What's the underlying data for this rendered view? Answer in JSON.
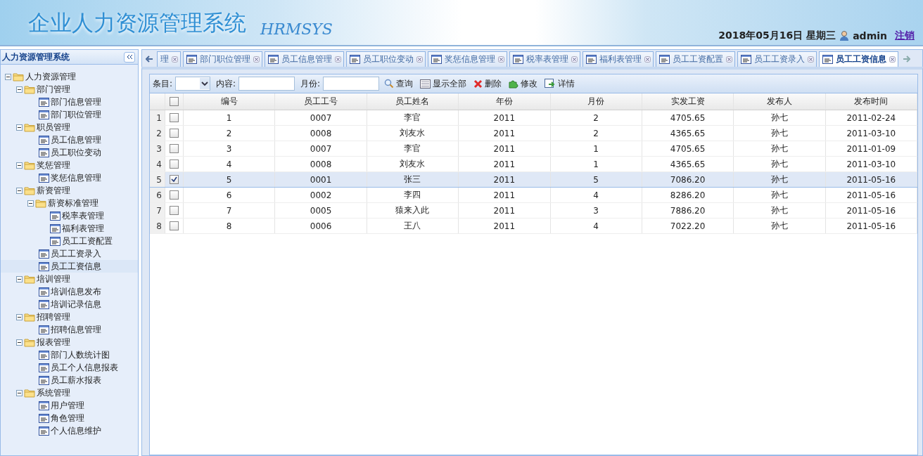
{
  "header": {
    "title": "企业人力资源管理系统",
    "subtitle": "HRMSYS",
    "date": "2018年05月16日 星期三",
    "user": "admin",
    "logout": "注销"
  },
  "sidebar": {
    "title": "人力资源管理系统",
    "tree": [
      {
        "label": "人力资源管理",
        "expanded": true,
        "children": [
          {
            "label": "部门管理",
            "expanded": true,
            "children": [
              {
                "label": "部门信息管理",
                "selected": false
              },
              {
                "label": "部门职位管理",
                "selected": false
              }
            ]
          },
          {
            "label": "职员管理",
            "expanded": true,
            "children": [
              {
                "label": "员工信息管理",
                "selected": false
              },
              {
                "label": "员工职位变动",
                "selected": false
              }
            ]
          },
          {
            "label": "奖惩管理",
            "expanded": true,
            "children": [
              {
                "label": "奖惩信息管理",
                "selected": false
              }
            ]
          },
          {
            "label": "薪资管理",
            "expanded": true,
            "children": [
              {
                "label": "薪资标准管理",
                "expanded": true,
                "children": [
                  {
                    "label": "税率表管理",
                    "selected": false
                  },
                  {
                    "label": "福利表管理",
                    "selected": false
                  },
                  {
                    "label": "员工工资配置",
                    "selected": false
                  }
                ]
              },
              {
                "label": "员工工资录入",
                "selected": false
              },
              {
                "label": "员工工资信息",
                "selected": true
              }
            ]
          },
          {
            "label": "培训管理",
            "expanded": true,
            "children": [
              {
                "label": "培训信息发布",
                "selected": false
              },
              {
                "label": "培训记录信息",
                "selected": false
              }
            ]
          },
          {
            "label": "招聘管理",
            "expanded": true,
            "children": [
              {
                "label": "招聘信息管理",
                "selected": false
              }
            ]
          },
          {
            "label": "报表管理",
            "expanded": true,
            "children": [
              {
                "label": "部门人数统计图",
                "selected": false
              },
              {
                "label": "员工个人信息报表",
                "selected": false
              },
              {
                "label": "员工薪水报表",
                "selected": false
              }
            ]
          },
          {
            "label": "系统管理",
            "expanded": true,
            "children": [
              {
                "label": "用户管理",
                "selected": false
              },
              {
                "label": "角色管理",
                "selected": false
              },
              {
                "label": "个人信息维护",
                "selected": false
              }
            ]
          }
        ]
      }
    ]
  },
  "tabs": [
    {
      "label": "理",
      "selected": false
    },
    {
      "label": "部门职位管理",
      "selected": false
    },
    {
      "label": "员工信息管理",
      "selected": false
    },
    {
      "label": "员工职位变动",
      "selected": false
    },
    {
      "label": "奖惩信息管理",
      "selected": false
    },
    {
      "label": "税率表管理",
      "selected": false
    },
    {
      "label": "福利表管理",
      "selected": false
    },
    {
      "label": "员工工资配置",
      "selected": false
    },
    {
      "label": "员工工资录入",
      "selected": false
    },
    {
      "label": "员工工资信息",
      "selected": true
    }
  ],
  "toolbar": {
    "fields": [
      {
        "label": "条目:",
        "kind": "select"
      },
      {
        "label": "内容:",
        "kind": "text"
      },
      {
        "label": "月份:",
        "kind": "text"
      }
    ],
    "buttons": [
      "查询",
      "显示全部",
      "删除",
      "修改",
      "详情"
    ]
  },
  "table": {
    "all_checked": false,
    "columns": [
      "编号",
      "员工工号",
      "员工姓名",
      "年份",
      "月份",
      "实发工资",
      "发布人",
      "发布时间"
    ],
    "rows": [
      {
        "index": "1",
        "checked": false,
        "cells": [
          "1",
          "0007",
          "李官",
          "2011",
          "2",
          "4705.65",
          "孙七",
          "2011-02-24"
        ]
      },
      {
        "index": "2",
        "checked": false,
        "cells": [
          "2",
          "0008",
          "刘友水",
          "2011",
          "2",
          "4365.65",
          "孙七",
          "2011-03-10"
        ]
      },
      {
        "index": "3",
        "checked": false,
        "cells": [
          "3",
          "0007",
          "李官",
          "2011",
          "1",
          "4705.65",
          "孙七",
          "2011-01-09"
        ]
      },
      {
        "index": "4",
        "checked": false,
        "cells": [
          "4",
          "0008",
          "刘友水",
          "2011",
          "1",
          "4365.65",
          "孙七",
          "2011-03-10"
        ]
      },
      {
        "index": "5",
        "checked": true,
        "cells": [
          "5",
          "0001",
          "张三",
          "2011",
          "5",
          "7086.20",
          "孙七",
          "2011-05-16"
        ]
      },
      {
        "index": "6",
        "checked": false,
        "cells": [
          "6",
          "0002",
          "李四",
          "2011",
          "4",
          "8286.20",
          "孙七",
          "2011-05-16"
        ]
      },
      {
        "index": "7",
        "checked": false,
        "cells": [
          "7",
          "0005",
          "猿来入此",
          "2011",
          "3",
          "7886.20",
          "孙七",
          "2011-05-16"
        ]
      },
      {
        "index": "8",
        "checked": false,
        "cells": [
          "8",
          "0006",
          "王八",
          "2011",
          "4",
          "7022.20",
          "孙七",
          "2011-05-16"
        ]
      }
    ]
  }
}
